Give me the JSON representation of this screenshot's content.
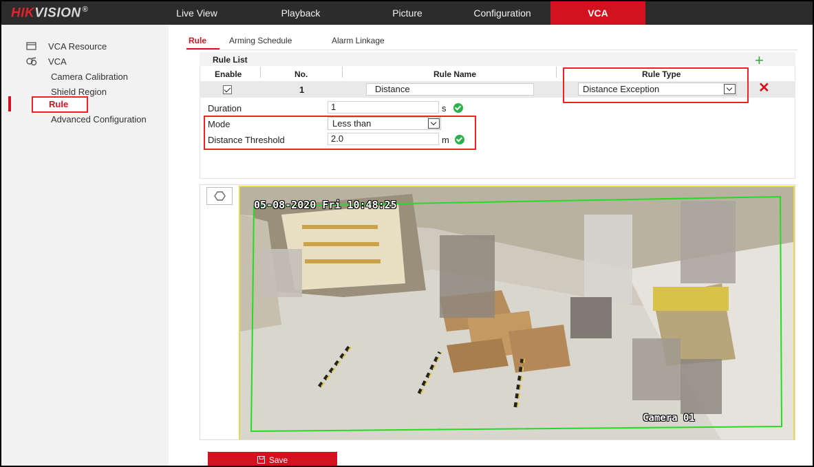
{
  "brand": {
    "logo_red": "HIK",
    "logo_grey": "VISION",
    "reg_mark": "®"
  },
  "nav": {
    "items": [
      {
        "label": "Live View"
      },
      {
        "label": "Playback"
      },
      {
        "label": "Picture"
      },
      {
        "label": "Configuration"
      },
      {
        "label": "VCA",
        "active": true
      }
    ]
  },
  "sidebar": {
    "items": [
      {
        "label": "VCA Resource",
        "icon": "monitor-icon"
      },
      {
        "label": "VCA",
        "icon": "vca-icon"
      },
      {
        "label": "Camera Calibration"
      },
      {
        "label": "Shield Region"
      },
      {
        "label": "Rule",
        "active": true
      },
      {
        "label": "Advanced Configuration"
      }
    ]
  },
  "tabs": [
    {
      "label": "Rule",
      "active": true
    },
    {
      "label": "Arming Schedule"
    },
    {
      "label": "Alarm Linkage"
    }
  ],
  "rule_list": {
    "title": "Rule List",
    "columns": {
      "enable": "Enable",
      "no": "No.",
      "name": "Rule Name",
      "type": "Rule Type"
    },
    "rows": [
      {
        "enabled": true,
        "no": "1",
        "name": "Distance",
        "type": "Distance Exception"
      }
    ]
  },
  "params": {
    "duration": {
      "label": "Duration",
      "value": "1",
      "unit": "s"
    },
    "mode": {
      "label": "Mode",
      "value": "Less than"
    },
    "threshold": {
      "label": "Distance Threshold",
      "value": "2.0",
      "unit": "m"
    }
  },
  "video": {
    "timestamp": "05-08-2020 Fri 10:48:25",
    "camera_name": "Camera 01"
  },
  "save": {
    "label": "Save"
  },
  "colors": {
    "accent": "#d3121f",
    "topbar": "#2c2c2c",
    "ok": "#2bb24c",
    "zone": "#22dd22"
  }
}
